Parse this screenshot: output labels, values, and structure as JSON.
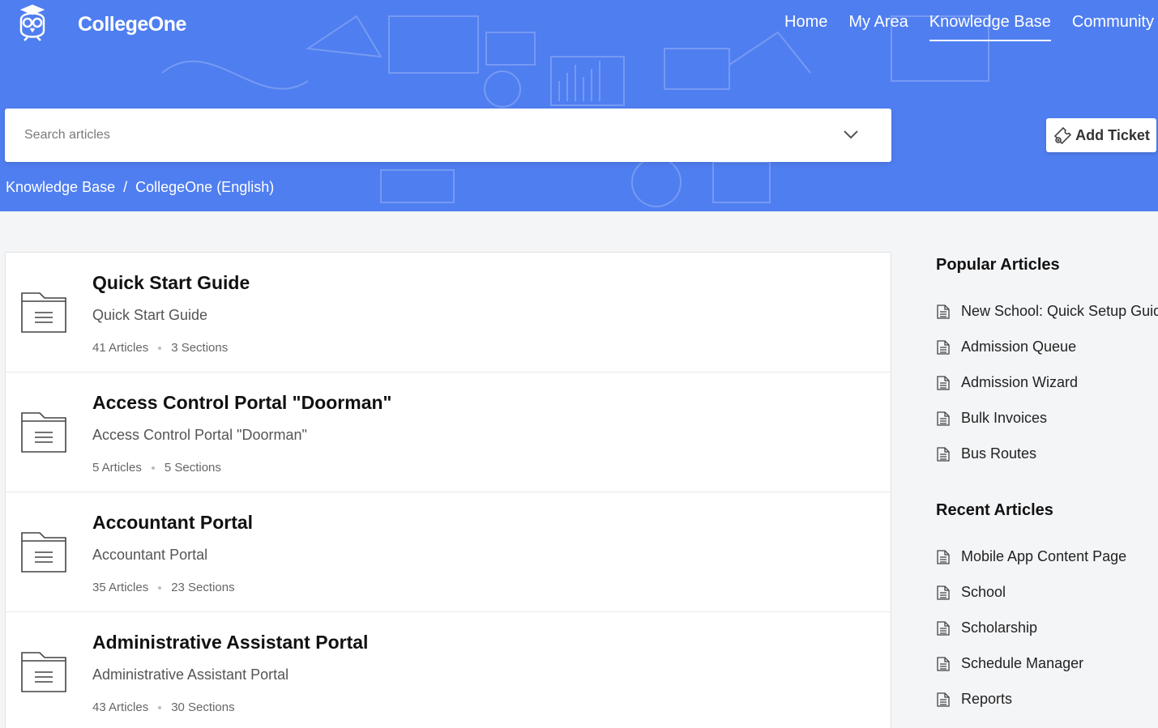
{
  "header": {
    "brand": "CollegeOne",
    "nav": [
      {
        "label": "Home"
      },
      {
        "label": "My Area"
      },
      {
        "label": "Knowledge Base"
      },
      {
        "label": "Community"
      }
    ]
  },
  "search": {
    "placeholder": "Search articles"
  },
  "add_ticket": {
    "label": "Add Ticket"
  },
  "breadcrumb": {
    "items": [
      "Knowledge Base",
      "CollegeOne (English)"
    ],
    "separator": "/"
  },
  "categories": [
    {
      "title": "Quick Start Guide",
      "description": "Quick Start Guide",
      "articles": "41 Articles",
      "sections": "3 Sections"
    },
    {
      "title": "Access Control Portal \"Doorman\"",
      "description": "Access Control Portal \"Doorman\"",
      "articles": "5 Articles",
      "sections": "5 Sections"
    },
    {
      "title": "Accountant Portal",
      "description": "Accountant Portal",
      "articles": "35 Articles",
      "sections": "23 Sections"
    },
    {
      "title": "Administrative Assistant Portal",
      "description": "Administrative Assistant Portal",
      "articles": "43 Articles",
      "sections": "30 Sections"
    }
  ],
  "popular": {
    "title": "Popular Articles",
    "items": [
      "New School: Quick Setup Guide",
      "Admission Queue",
      "Admission Wizard",
      "Bulk Invoices",
      "Bus Routes"
    ]
  },
  "recent": {
    "title": "Recent Articles",
    "items": [
      "Mobile App Content Page",
      "School",
      "Scholarship",
      "Schedule Manager",
      "Reports"
    ]
  },
  "colors": {
    "banner": "#4f7ef0",
    "background": "#f4f5f7"
  },
  "icons": {
    "logo": "owl-logo-icon",
    "search_toggle": "chevron-down-icon",
    "ticket": "ticket-icon",
    "category": "folder-icon",
    "article": "document-icon"
  }
}
